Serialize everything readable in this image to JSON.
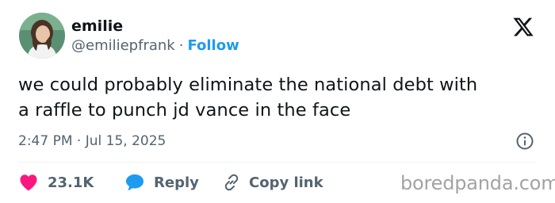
{
  "user": {
    "display_name": "emilie",
    "handle": "@emiliepfrank",
    "separator": "·",
    "follow_label": "Follow",
    "avatar_icon": "profile-photo"
  },
  "platform": {
    "logo_icon": "x-logo-icon"
  },
  "tweet": {
    "text_lines": [
      "we could probably eliminate the national debt with",
      "a raffle to punch jd vance in the face"
    ],
    "timestamp": "2:47 PM · Jul 15, 2025",
    "info_icon": "info-icon"
  },
  "actions": {
    "like": {
      "icon": "heart-icon",
      "count": "23.1K",
      "color": "#f91880"
    },
    "reply": {
      "icon": "speech-bubble-icon",
      "label": "Reply",
      "color": "#1d9bf0"
    },
    "copy": {
      "icon": "link-icon",
      "label": "Copy link"
    }
  },
  "watermark": "boredpanda.com",
  "colors": {
    "accent": "#1d9bf0",
    "text_primary": "#0f1419",
    "text_secondary": "#536471",
    "like": "#f91880",
    "divider": "#eff3f4"
  }
}
